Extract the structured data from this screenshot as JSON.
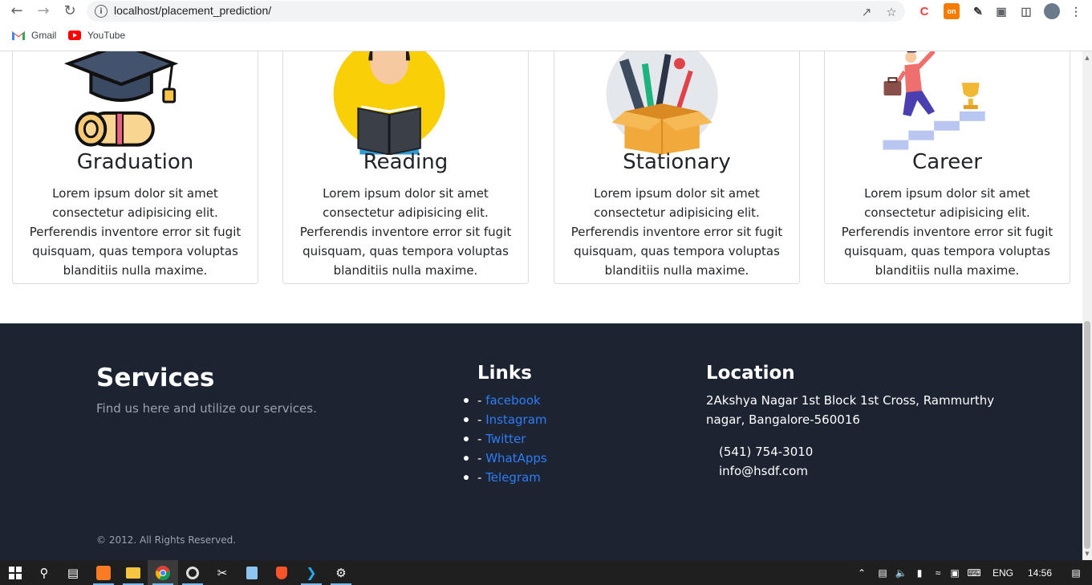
{
  "browser": {
    "url": "localhost/placement_prediction/",
    "bookmarks": [
      {
        "label": "Gmail",
        "icon": "gmail-icon"
      },
      {
        "label": "YouTube",
        "icon": "youtube-icon"
      }
    ],
    "extensions": [
      {
        "name": "extension-c-icon",
        "label": "C",
        "color": "#e8453c"
      },
      {
        "name": "extension-on-icon",
        "label": "on",
        "color": "#f57c00"
      },
      {
        "name": "extension-pen-icon",
        "label": "✎",
        "color": "#333333"
      }
    ]
  },
  "cards": [
    {
      "title": "Graduation",
      "illustration": "graduation-cap-diploma",
      "description": "Lorem ipsum dolor sit amet consectetur adipisicing elit. Perferendis inventore error sit fugit quisquam, quas tempora voluptas blanditiis nulla maxime."
    },
    {
      "title": "Reading",
      "illustration": "child-reading-book",
      "description": "Lorem ipsum dolor sit amet consectetur adipisicing elit. Perferendis inventore error sit fugit quisquam, quas tempora voluptas blanditiis nulla maxime."
    },
    {
      "title": "Stationary",
      "illustration": "stationery-box",
      "description": "Lorem ipsum dolor sit amet consectetur adipisicing elit. Perferendis inventore error sit fugit quisquam, quas tempora voluptas blanditiis nulla maxime."
    },
    {
      "title": "Career",
      "illustration": "career-stairs-trophy",
      "description": "Lorem ipsum dolor sit amet consectetur adipisicing elit. Perferendis inventore error sit fugit quisquam, quas tempora voluptas blanditiis nulla maxime."
    }
  ],
  "footer": {
    "services_title": "Services",
    "services_subtitle": "Find us here and utilize our services.",
    "links_title": "Links",
    "links": [
      {
        "prefix": "- ",
        "label": "facebook"
      },
      {
        "prefix": "- ",
        "label": "Instagram"
      },
      {
        "prefix": "- ",
        "label": "Twitter"
      },
      {
        "prefix": "- ",
        "label": "WhatApps"
      },
      {
        "prefix": "- ",
        "label": "Telegram"
      }
    ],
    "location_title": "Location",
    "address": "2Akshya Nagar 1st Block 1st Cross, Rammurthy nagar, Bangalore-560016",
    "phone": "(541) 754-3010",
    "email": "info@hsdf.com",
    "copyright": "© 2012. All Rights Reserved.",
    "background": "#1c2331",
    "link_color": "#2f7cf6"
  },
  "taskbar": {
    "language": "ENG",
    "time": "14:56"
  }
}
